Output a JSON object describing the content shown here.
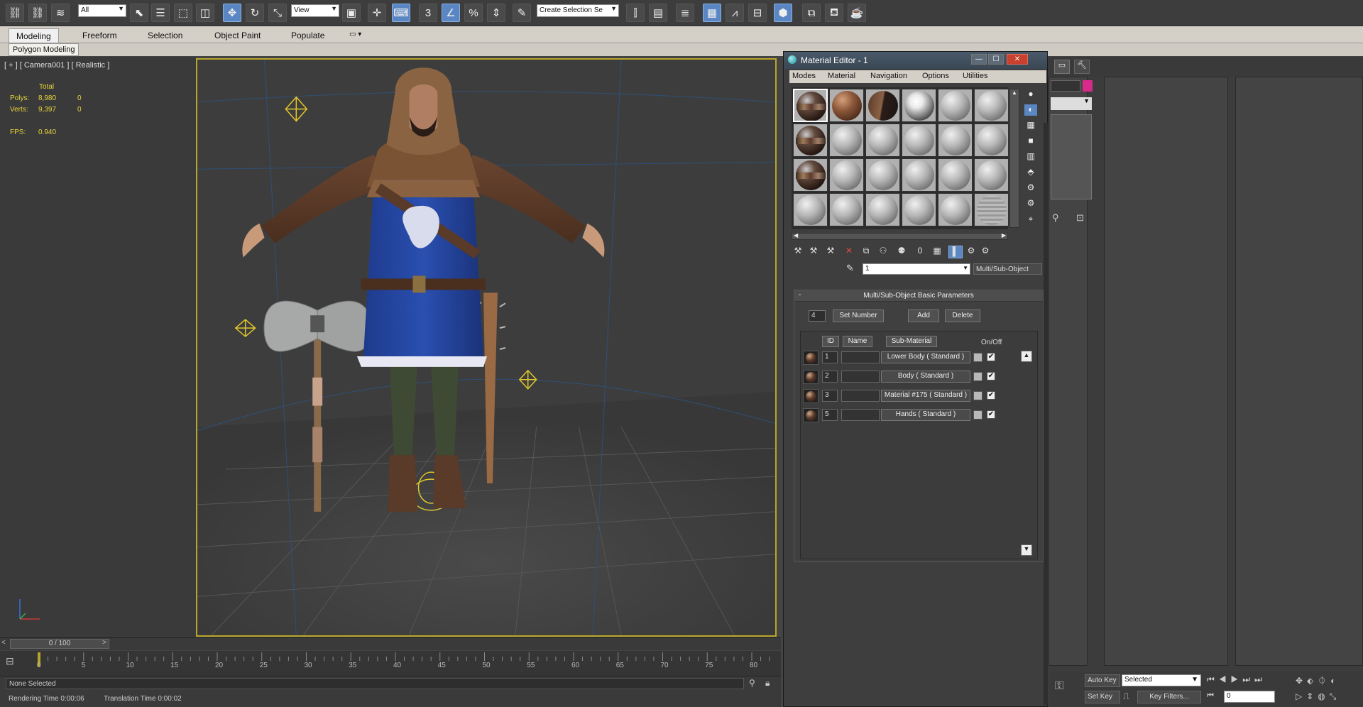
{
  "toolbar": {
    "filter_select": "All",
    "ref_coord": "View",
    "named_selection": "Create Selection Se"
  },
  "ribbon": {
    "tabs": [
      "Modeling",
      "Freeform",
      "Selection",
      "Object Paint",
      "Populate"
    ],
    "sub_tab": "Polygon Modeling"
  },
  "viewport": {
    "label": "[ + ] [ Camera001 ] [ Realistic ]",
    "stats": {
      "total_label": "Total",
      "polys_label": "Polys:",
      "polys_total": "8,980",
      "polys_sel": "0",
      "verts_label": "Verts:",
      "verts_total": "9,397",
      "verts_sel": "0",
      "fps_label": "FPS:",
      "fps_value": "0.940"
    }
  },
  "timeline": {
    "frame": "0 / 100",
    "ticks": [
      "0",
      "5",
      "10",
      "15",
      "20",
      "25",
      "30",
      "35",
      "40",
      "45",
      "50",
      "55",
      "60",
      "65",
      "70",
      "75",
      "80"
    ]
  },
  "status": {
    "selection": "None Selected",
    "rendering_time": "Rendering Time  0:00:06",
    "translation_time": "Translation Time  0:00:02"
  },
  "anim_controls": {
    "auto_key": "Auto Key",
    "selected": "Selected",
    "set_key": "Set Key",
    "key_filters": "Key Filters...",
    "frame_input": "0"
  },
  "material_editor": {
    "title": "Material Editor - 1",
    "menu": [
      "Modes",
      "Material",
      "Navigation",
      "Options",
      "Utilities"
    ],
    "material_name": "1",
    "material_type": "Multi/Sub-Object",
    "rollout": {
      "title": "Multi/Sub-Object Basic Parameters",
      "count": "4",
      "set_number": "Set Number",
      "add": "Add",
      "delete": "Delete",
      "col_id": "ID",
      "col_name": "Name",
      "col_submat": "Sub-Material",
      "col_onoff": "On/Off",
      "rows": [
        {
          "id": "1",
          "submat": "Lower Body  ( Standard )"
        },
        {
          "id": "2",
          "submat": "Body  ( Standard )"
        },
        {
          "id": "3",
          "submat": "Material #175  ( Standard )"
        },
        {
          "id": "5",
          "submat": "Hands  ( Standard )"
        }
      ]
    }
  }
}
